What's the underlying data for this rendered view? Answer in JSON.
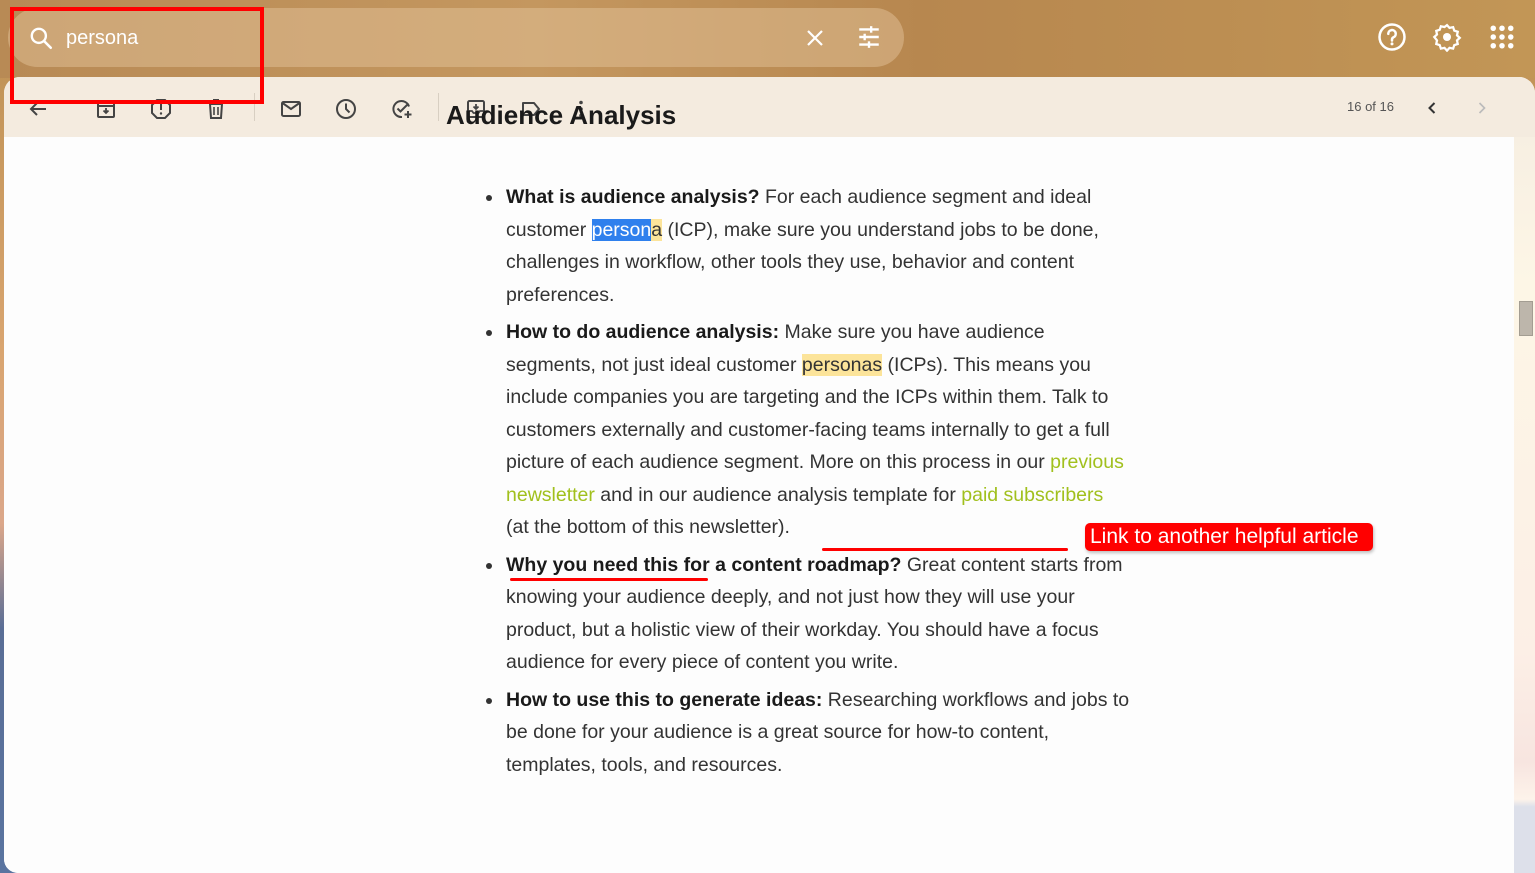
{
  "search": {
    "value": "persona",
    "clear_label": "Clear search",
    "options_label": "Show search options"
  },
  "header_icons": [
    "help-icon",
    "settings-icon",
    "apps-icon"
  ],
  "toolbar": {
    "icons": [
      "back",
      "archive",
      "report-spam",
      "delete",
      "mark-unread",
      "snooze",
      "add-to-tasks",
      "move-to",
      "labels",
      "more"
    ],
    "pager": "16 of 16"
  },
  "article": {
    "title": "Audience Analysis",
    "items": [
      {
        "bold": "What is audience analysis?",
        "text_a": " For each audience segment and ideal customer ",
        "sel": "person",
        "hl": "a",
        "text_b": " (ICP), make sure you understand jobs to be done, challenges in workflow, other tools they use, behavior and content preferences."
      },
      {
        "bold": "How to do audience analysis:",
        "text_a": " Make sure you have audience segments, not just ideal customer ",
        "hl": "personas",
        "text_b": " (ICPs). This means you include companies you are targeting and the ICPs within them. Talk to customers externally and customer-facing teams internally to get a full picture of each audience segment. More on this process in our ",
        "link1": "previous newsletter",
        "text_c": " and in our audience analysis template for ",
        "link2": "paid subscribers",
        "text_d": " (at the bottom of this newsletter)."
      },
      {
        "bold": "Why you need this for a content roadmap?",
        "text": " Great content starts from knowing your audience deeply, and not just how they will use your product, but a holistic view of their workday. You should have a focus audience for every piece of content you write."
      },
      {
        "bold": "How to use this to generate ideas:",
        "text": " Researching workflows and jobs to be done for your audience is a great source for how-to content, templates, tools, and resources."
      }
    ]
  },
  "annotation": {
    "label": "Link to another helpful article",
    "color": "#ff0000"
  },
  "colors": {
    "link": "#a1c01d",
    "highlight": "#fce49a",
    "selection": "#2f80ed"
  }
}
